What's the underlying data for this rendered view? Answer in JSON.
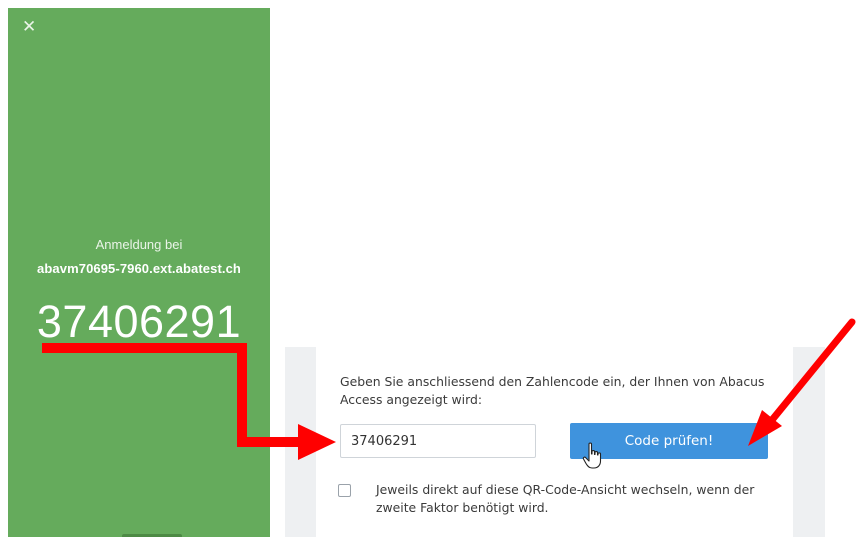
{
  "phone": {
    "close_icon": "close-icon",
    "login_label": "Anmeldung bei",
    "host": "abavm70695-7960.ext.abatest.ch",
    "code": "37406291",
    "background_color": "#65ab5c"
  },
  "form": {
    "instruction": "Geben Sie anschliessend den Zahlencode ein, der Ihnen von Abacus Access angezeigt wird:",
    "code_value": "37406291",
    "submit_label": "Code prüfen!",
    "checkbox_label": "Jeweils direkt auf diese QR-Code-Ansicht wechseln, wenn der zweite Faktor benötigt wird.",
    "checkbox_checked": false,
    "button_color": "#3f93dd"
  },
  "annotations": {
    "arrow_color": "#ff0000"
  }
}
